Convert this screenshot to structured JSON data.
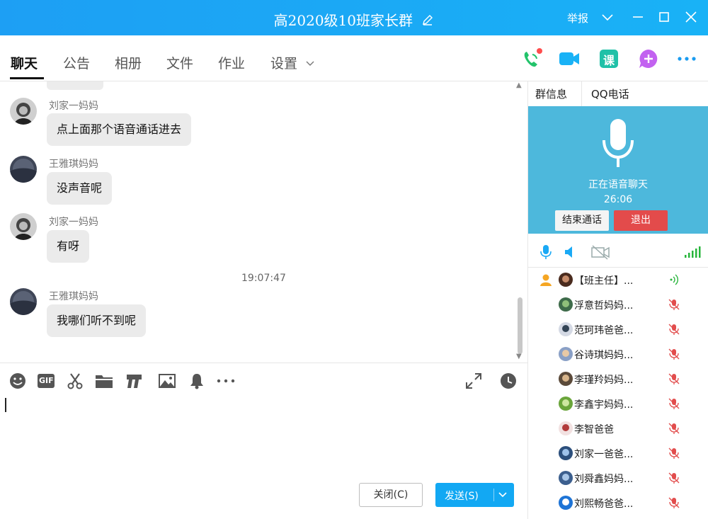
{
  "window": {
    "title": "高2020级10班家长群",
    "report_label": "举报",
    "accent": "#1aa9f5"
  },
  "tabs": [
    {
      "label": "聊天",
      "active": true
    },
    {
      "label": "公告"
    },
    {
      "label": "相册"
    },
    {
      "label": "文件"
    },
    {
      "label": "作业"
    },
    {
      "label": "设置"
    }
  ],
  "header_icons": [
    "voice-call-icon",
    "video-call-icon",
    "course-icon",
    "add-app-icon",
    "more-icon"
  ],
  "course_icon_text": "课",
  "chat": {
    "messages": [
      {
        "sender": "刘家一妈妈",
        "text": "点上面那个语音通话进去"
      },
      {
        "sender": "王雅琪妈妈",
        "text": "没声音呢"
      },
      {
        "sender": "刘家一妈妈",
        "text": "有呀"
      },
      {
        "sender": "王雅琪妈妈",
        "text": "我哪们听不到呢"
      }
    ],
    "timestamp": "19:07:47"
  },
  "toolbar_icons": [
    "emoji-icon",
    "gif-icon",
    "screenshot-icon",
    "folder-icon",
    "music-icon",
    "image-icon",
    "bell-icon",
    "more-icon",
    "expand-icon",
    "history-icon"
  ],
  "gif_text": "GIF",
  "buttons": {
    "close": "关闭(C)",
    "send": "发送(S)"
  },
  "right_panel": {
    "tabs": [
      "群信息",
      "QQ电话"
    ],
    "voice": {
      "status": "正在语音聊天",
      "duration": "26:06",
      "end_call": "结束通话",
      "exit": "退出",
      "panel_color": "#4db8dc"
    },
    "members": [
      {
        "name": "【班主任】...",
        "role": "owner",
        "speaking": true
      },
      {
        "name": "浮意哲妈妈...",
        "muted": true
      },
      {
        "name": "范珂玮爸爸...",
        "muted": true
      },
      {
        "name": "谷诗琪妈妈...",
        "muted": true
      },
      {
        "name": "李瑾羚妈妈...",
        "muted": true
      },
      {
        "name": "李鑫宇妈妈...",
        "muted": true
      },
      {
        "name": "李智爸爸",
        "muted": true
      },
      {
        "name": "刘家一爸爸...",
        "muted": true
      },
      {
        "name": "刘舜鑫妈妈...",
        "muted": true
      },
      {
        "name": "刘熙畅爸爸...",
        "muted": true
      }
    ]
  }
}
